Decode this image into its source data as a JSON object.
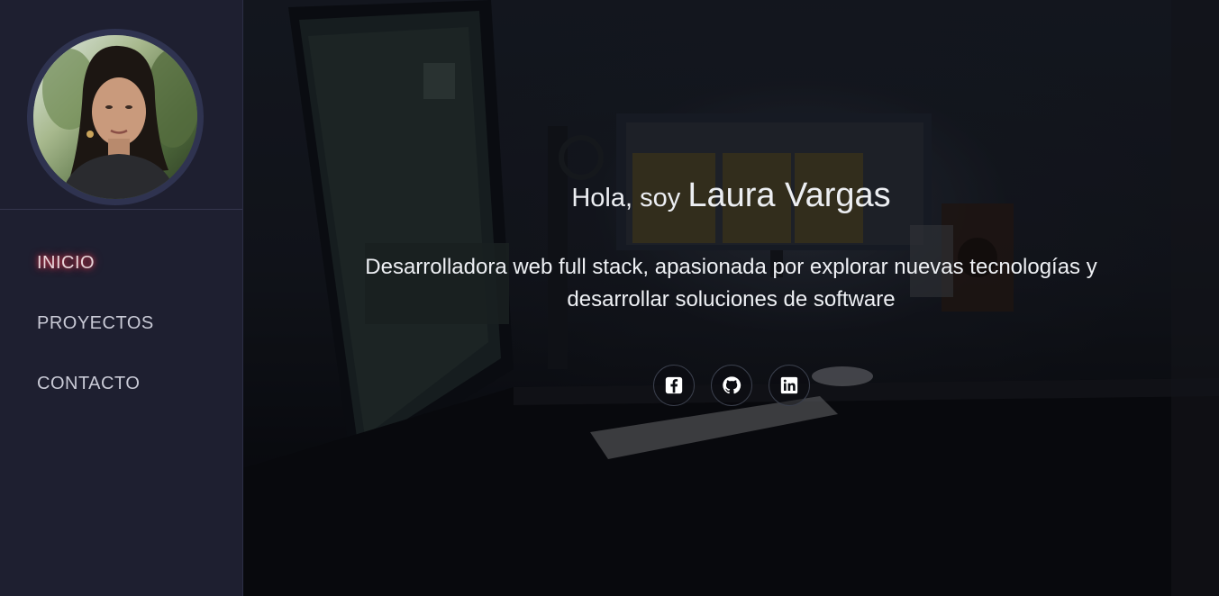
{
  "profile": {
    "avatar_icon": "person-photo"
  },
  "nav": {
    "items": [
      {
        "label": "INICIO",
        "active": true
      },
      {
        "label": "PROYECTOS",
        "active": false
      },
      {
        "label": "CONTACTO",
        "active": false
      }
    ]
  },
  "hero": {
    "greeting_prefix": "Hola, soy",
    "name": "Laura Vargas",
    "tagline": "Desarrolladora web full stack, apasionada por explorar nuevas tecnologías y desarrollar soluciones de software",
    "socials": [
      {
        "icon": "facebook-icon"
      },
      {
        "icon": "github-icon"
      },
      {
        "icon": "linkedin-icon"
      }
    ]
  },
  "colors": {
    "sidebar_bg": "#1e1f30",
    "active_glow": "#d0374a",
    "text_primary": "#f2f3f6"
  }
}
